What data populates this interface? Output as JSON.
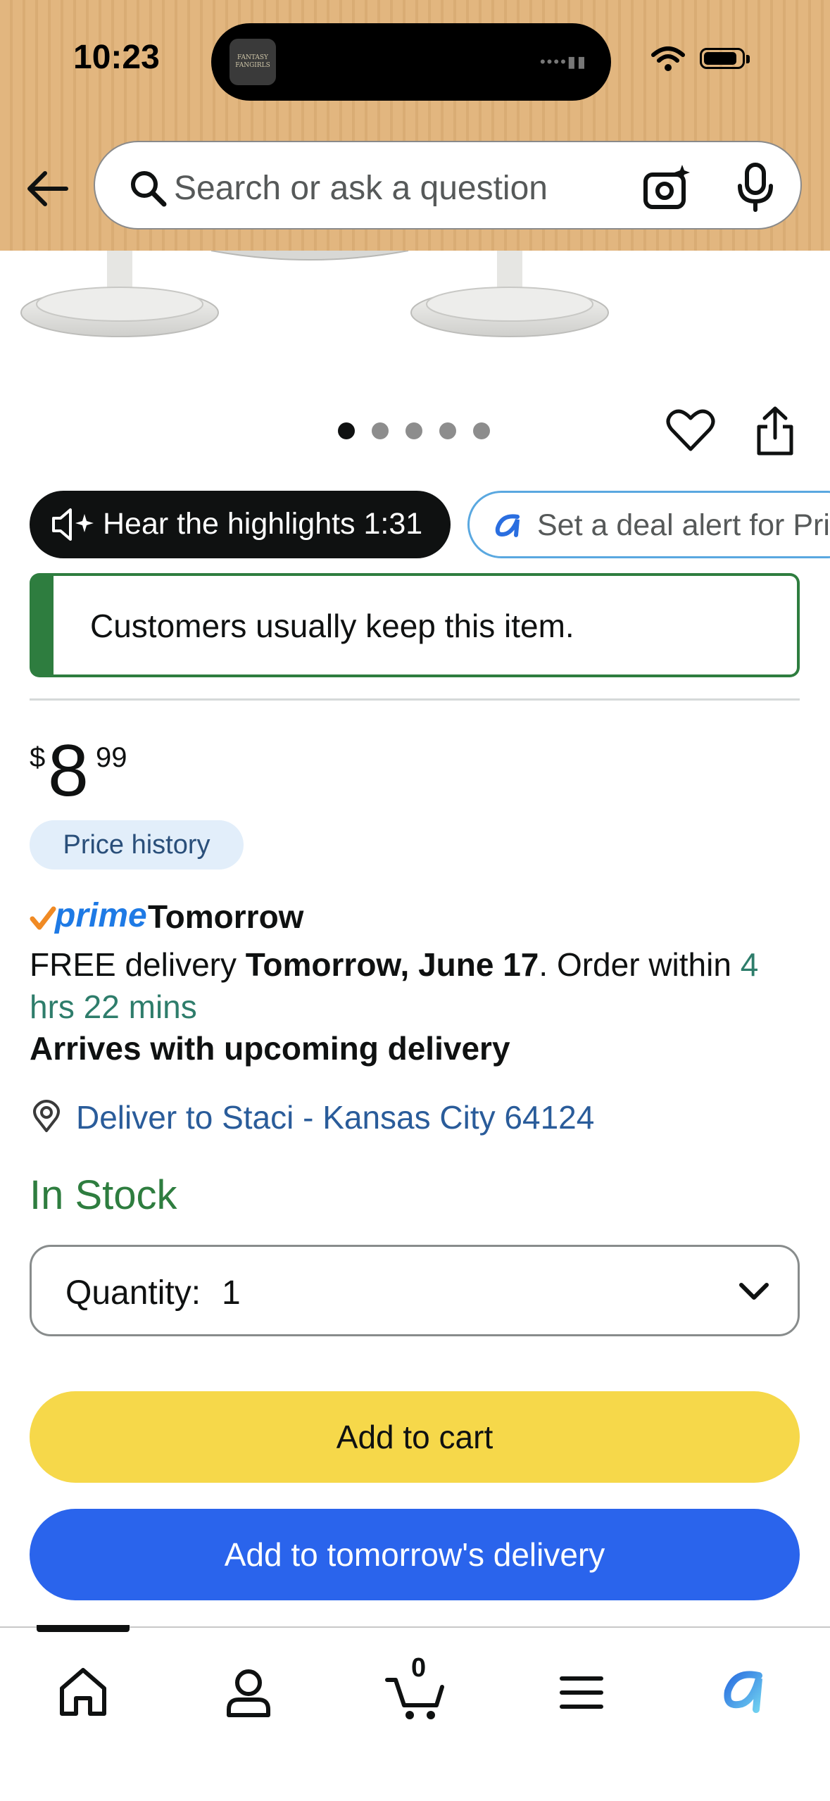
{
  "status_bar": {
    "time": "10:23",
    "island_app_label": "FANTASY FANGIRLS"
  },
  "header": {
    "search_placeholder": "Search or ask a question",
    "brand_color": "#e2b67f"
  },
  "gallery": {
    "image_count": 5,
    "active_index": 0
  },
  "chips": {
    "highlights_label": "Hear the highlights 1:31",
    "deal_alert_label": "Set a deal alert for Pri"
  },
  "keep_banner": {
    "text": "Customers usually keep this item."
  },
  "price": {
    "symbol": "$",
    "whole": "8",
    "fraction": "99"
  },
  "price_history_label": "Price history",
  "prime": {
    "brand": "prime",
    "speed": "Tomorrow"
  },
  "delivery": {
    "prefix": "FREE delivery ",
    "date": "Tomorrow, June 17",
    "middle": ". Order within ",
    "countdown": "4 hrs 22 mins",
    "arrives": "Arrives with upcoming delivery",
    "deliver_to": "Deliver to Staci - Kansas City 64124"
  },
  "stock_status": "In Stock",
  "quantity": {
    "label": "Quantity:",
    "value": "1"
  },
  "buttons": {
    "add_to_cart": "Add to cart",
    "add_to_tomorrow": "Add to tomorrow's delivery"
  },
  "bottom_nav": {
    "cart_count": "0",
    "items": [
      "home-icon",
      "account-icon",
      "cart-icon",
      "menu-icon",
      "rufus-icon"
    ]
  }
}
